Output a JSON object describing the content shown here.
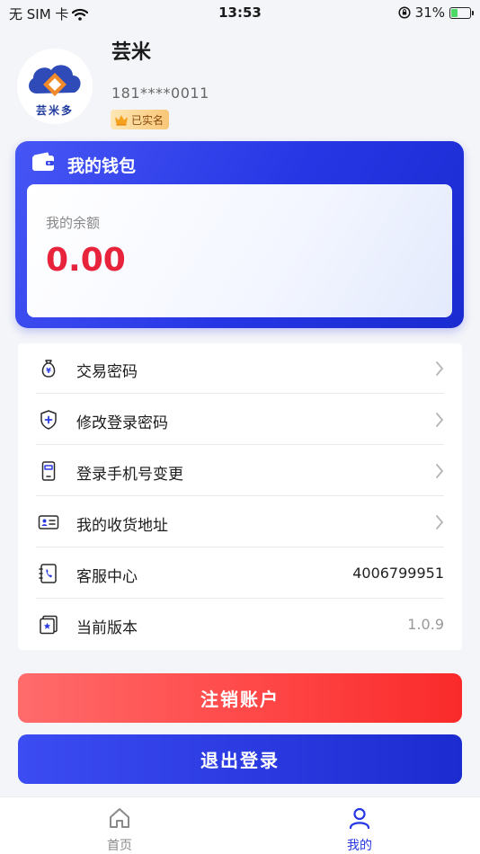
{
  "status_bar": {
    "carrier": "无 SIM 卡",
    "time": "13:53",
    "battery_percent": "31%",
    "battery_level": 0.31
  },
  "profile": {
    "name": "芸米",
    "phone": "181****0011",
    "verified_label": "已实名",
    "avatar_logo_text": "芸米多"
  },
  "wallet": {
    "title": "我的钱包",
    "balance_label": "我的余额",
    "balance_value": "0.00"
  },
  "menu": {
    "items": [
      {
        "label": "交易密码",
        "icon": "money-bag-icon"
      },
      {
        "label": "修改登录密码",
        "icon": "shield-plus-icon"
      },
      {
        "label": "登录手机号变更",
        "icon": "phone-icon"
      },
      {
        "label": "我的收货地址",
        "icon": "id-card-icon"
      },
      {
        "label": "客服中心",
        "icon": "contact-book-icon",
        "value": "4006799951"
      },
      {
        "label": "当前版本",
        "icon": "version-icon",
        "value": "1.0.9"
      }
    ]
  },
  "actions": {
    "deregister_label": "注销账户",
    "logout_label": "退出登录"
  },
  "tabbar": {
    "tabs": [
      {
        "label": "首页",
        "icon": "home-icon"
      },
      {
        "label": "我的",
        "icon": "user-icon"
      }
    ]
  },
  "colors": {
    "accent": "#2636e4",
    "danger": "#fa3a3a",
    "balance": "#e8243c"
  }
}
